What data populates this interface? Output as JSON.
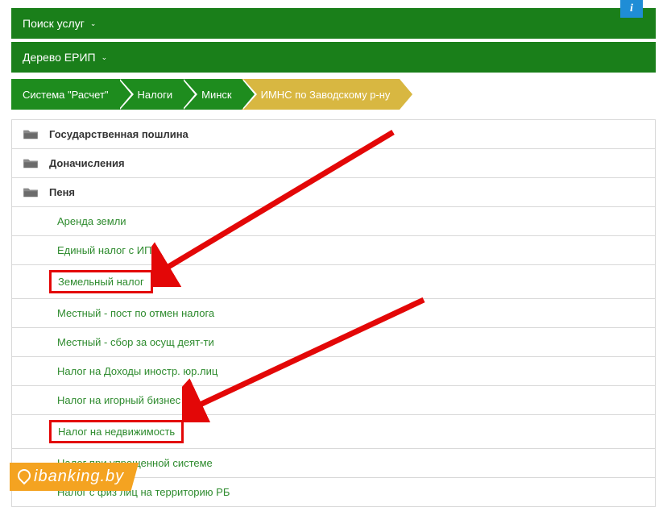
{
  "info_button": "i",
  "search_services": "Поиск услуг",
  "erip_tree": "Дерево ЕРИП",
  "breadcrumb": [
    {
      "label": "Система \"Расчет\"",
      "color": "green"
    },
    {
      "label": "Налоги",
      "color": "green"
    },
    {
      "label": "Минск",
      "color": "green"
    },
    {
      "label": "ИМНС по Заводскому р-ну",
      "color": "yellow"
    }
  ],
  "rows": [
    {
      "type": "folder",
      "label": "Государственная пошлина"
    },
    {
      "type": "folder",
      "label": "Доначисления"
    },
    {
      "type": "folder",
      "label": "Пеня"
    },
    {
      "type": "item",
      "label": "Аренда земли"
    },
    {
      "type": "item",
      "label": "Единый налог с ИП"
    },
    {
      "type": "item",
      "label": "Земельный налог",
      "highlight": true
    },
    {
      "type": "item",
      "label": "Местный - пост по отмен налога"
    },
    {
      "type": "item",
      "label": "Местный - сбор за осущ деят-ти"
    },
    {
      "type": "item",
      "label": "Налог на Доходы иностр. юр.лиц"
    },
    {
      "type": "item",
      "label": "Налог на игорный бизнес"
    },
    {
      "type": "item",
      "label": "Налог на недвижимость",
      "highlight": true
    },
    {
      "type": "item",
      "label": "Налог при упрощенной системе"
    },
    {
      "type": "item",
      "label": "Налог с физ лиц на территорию РБ"
    }
  ],
  "watermark": "ibanking.by"
}
